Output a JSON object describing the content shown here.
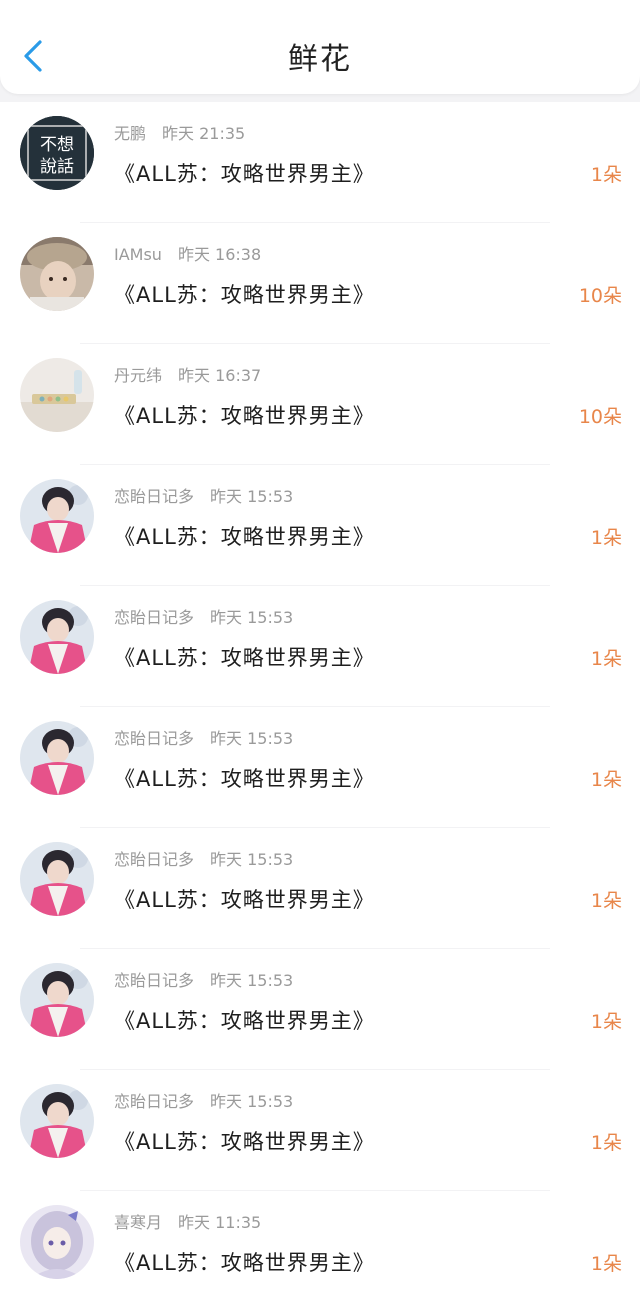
{
  "header": {
    "title": "鲜花",
    "back_icon": "chevron-left-icon",
    "accent_color": "#2a9be8"
  },
  "colors": {
    "count": "#e8864a",
    "meta": "#9a9a9a",
    "book": "#1e1e1e"
  },
  "avatar1_text": {
    "line1": "不想",
    "line2": "說話"
  },
  "items": [
    {
      "name": "无鹏",
      "time": "昨天 21:35",
      "book": "《ALL苏：攻略世界男主》",
      "count": "1朵",
      "avatar": "text-avatar"
    },
    {
      "name": "IAMsu",
      "time": "昨天 16:38",
      "book": "《ALL苏：攻略世界男主》",
      "count": "10朵",
      "avatar": "photo-avatar"
    },
    {
      "name": "丹元纬",
      "time": "昨天 16:37",
      "book": "《ALL苏：攻略世界男主》",
      "count": "10朵",
      "avatar": "still-life-avatar"
    },
    {
      "name": "恋眙日记多",
      "time": "昨天 15:53",
      "book": "《ALL苏：攻略世界男主》",
      "count": "1朵",
      "avatar": "pink-jacket-avatar"
    },
    {
      "name": "恋眙日记多",
      "time": "昨天 15:53",
      "book": "《ALL苏：攻略世界男主》",
      "count": "1朵",
      "avatar": "pink-jacket-avatar"
    },
    {
      "name": "恋眙日记多",
      "time": "昨天 15:53",
      "book": "《ALL苏：攻略世界男主》",
      "count": "1朵",
      "avatar": "pink-jacket-avatar"
    },
    {
      "name": "恋眙日记多",
      "time": "昨天 15:53",
      "book": "《ALL苏：攻略世界男主》",
      "count": "1朵",
      "avatar": "pink-jacket-avatar"
    },
    {
      "name": "恋眙日记多",
      "time": "昨天 15:53",
      "book": "《ALL苏：攻略世界男主》",
      "count": "1朵",
      "avatar": "pink-jacket-avatar"
    },
    {
      "name": "恋眙日记多",
      "time": "昨天 15:53",
      "book": "《ALL苏：攻略世界男主》",
      "count": "1朵",
      "avatar": "pink-jacket-avatar"
    },
    {
      "name": "喜寒月",
      "time": "昨天 11:35",
      "book": "《ALL苏：攻略世界男主》",
      "count": "1朵",
      "avatar": "anime-girl-avatar"
    }
  ]
}
